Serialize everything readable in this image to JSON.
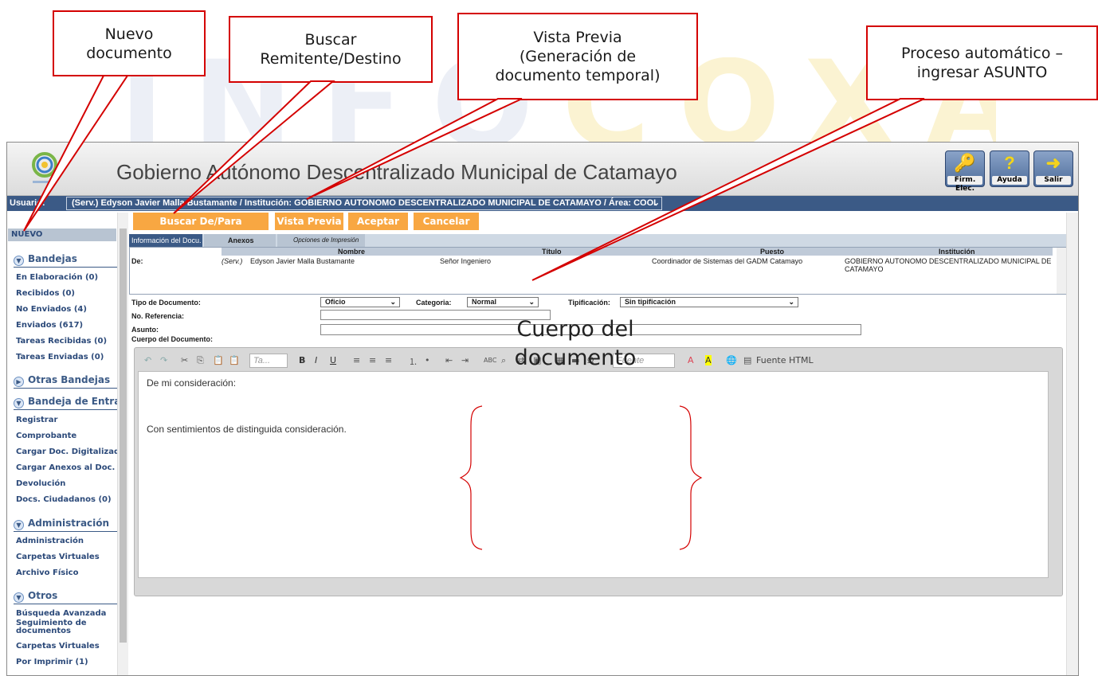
{
  "callouts": {
    "nuevo": "Nuevo\ndocumento",
    "buscar": "Buscar\nRemitente/Destino",
    "vista": "Vista Previa\n(Generación de\ndocumento temporal)",
    "proceso": "Proceso automático –\ningresar ASUNTO",
    "cuerpo": "Cuerpo del\ndocumento"
  },
  "app": {
    "title": "Gobierno Autónomo Descentralizado Municipal de Catamayo",
    "user_label": "Usuario:",
    "user_value": "(Serv.) Edyson Javier Malla Bustamante / Institución: GOBIERNO AUTONOMO DESCENTRALIZADO MUNICIPAL DE CATAMAYO / Área: COOI",
    "header_buttons": [
      "Firm. Elec.",
      "Ayuda",
      "Salir"
    ]
  },
  "sidebar": {
    "nuevo": "NUEVO",
    "bandejas_title": "Bandejas",
    "bandejas": [
      "En Elaboración (0)",
      "Recibidos (0)",
      "No Enviados (4)",
      "Enviados (617)",
      "Tareas Recibidas (0)",
      "Tareas Enviadas (0)"
    ],
    "otras_title": "Otras Bandejas",
    "entrada_title": "Bandeja de Entrada",
    "entrada": [
      "Registrar",
      "Comprobante",
      "Cargar Doc. Digitalizado",
      "Cargar Anexos al Doc.",
      "Devolución",
      "Docs. Ciudadanos (0)"
    ],
    "admin_title": "Administración",
    "admin": [
      "Administración",
      "Carpetas Virtuales",
      "Archivo Físico"
    ],
    "otros_title": "Otros",
    "otros": [
      "Búsqueda Avanzada",
      "Seguimiento de documentos",
      "Carpetas Virtuales",
      "Por Imprimir (1)"
    ]
  },
  "actions": {
    "buscar": "Buscar De/Para",
    "vista": "Vista Previa",
    "aceptar": "Aceptar",
    "cancelar": "Cancelar"
  },
  "tabs": [
    "Información del Docu.",
    "Anexos",
    "Opciones de Impresión"
  ],
  "grid": {
    "columns": [
      "Nombre",
      "Título",
      "Puesto",
      "Institución"
    ],
    "row": {
      "label": "De:",
      "prefix": "(Serv.)",
      "nombre": "Edyson Javier Malla Bustamante",
      "titulo": "Señor Ingeniero",
      "puesto": "Coordinador de Sistemas del GADM Catamayo",
      "institucion": "GOBIERNO AUTONOMO DESCENTRALIZADO MUNICIPAL DE CATAMAYO"
    }
  },
  "form": {
    "tipo_label": "Tipo de Documento:",
    "tipo_value": "Oficio",
    "categoria_label": "Categoria:",
    "categoria_value": "Normal",
    "tipificacion_label": "Tipificación:",
    "tipificacion_value": "Sin tipificación",
    "referencia_label": "No. Referencia:",
    "asunto_label": "Asunto:",
    "cuerpo_label": "Cuerpo del Documento:"
  },
  "editor": {
    "font_placeholder": "Ta...",
    "fuente_placeholder": "Fuente",
    "html_label": "Fuente HTML",
    "line1": "De mi consideración:",
    "line2": "Con sentimientos de distinguida consideración."
  },
  "watermark": "INFOCOXA"
}
